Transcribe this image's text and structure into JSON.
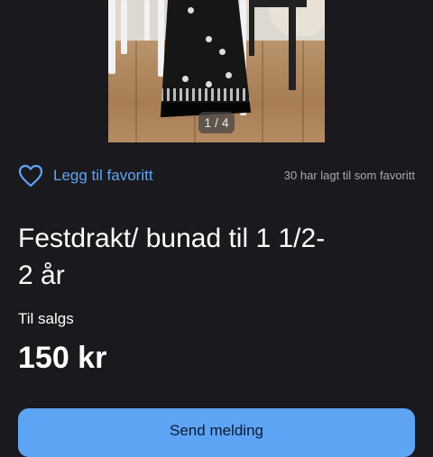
{
  "gallery": {
    "image_counter": "1 / 4",
    "image_subject": "festdrakt-bunad-photo"
  },
  "favorite": {
    "label": "Legg til favoritt",
    "count_text": "30 har lagt til som favoritt",
    "icon": "heart-outline-icon"
  },
  "listing": {
    "title": "Festdrakt/ bunad til 1 1/2-\n2 år",
    "sale_type": "Til salgs",
    "price": "150 kr"
  },
  "actions": {
    "send_message_label": "Send melding"
  },
  "colors": {
    "background": "#1a1a1e",
    "accent": "#5ea4f5",
    "muted_text": "#a9a9ae"
  }
}
